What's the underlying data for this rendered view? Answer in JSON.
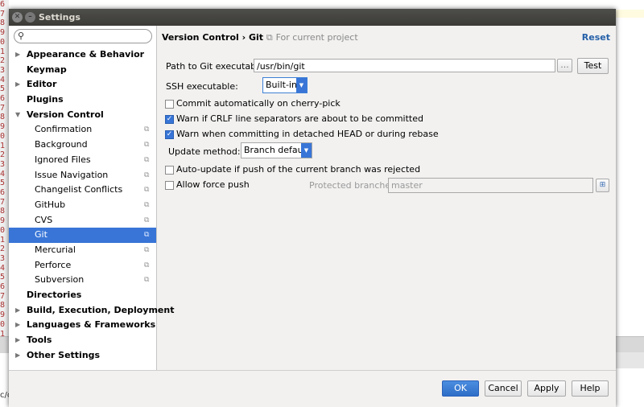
{
  "dialog": {
    "title": "Settings"
  },
  "gutter_lines": [
    "6",
    "7",
    "8",
    "9",
    "0",
    "1",
    "2",
    "3",
    "4",
    "5",
    "6",
    "7",
    "8",
    "9",
    "0",
    "1",
    "2",
    "3",
    "4",
    "5",
    "6",
    "7",
    "8",
    "9",
    "0",
    "1",
    "2",
    "3",
    "4",
    "5",
    "6",
    "7",
    "8",
    "9",
    "0",
    "1"
  ],
  "background_bottom_text": "c/c",
  "search": {
    "placeholder": ""
  },
  "tree": [
    {
      "label": "Appearance & Behavior",
      "level": 0,
      "expandable": true
    },
    {
      "label": "Keymap",
      "level": 0,
      "expandable": false
    },
    {
      "label": "Editor",
      "level": 0,
      "expandable": true
    },
    {
      "label": "Plugins",
      "level": 0,
      "expandable": false
    },
    {
      "label": "Version Control",
      "level": 0,
      "expandable": true,
      "expanded": true
    },
    {
      "label": "Confirmation",
      "level": 1
    },
    {
      "label": "Background",
      "level": 1
    },
    {
      "label": "Ignored Files",
      "level": 1
    },
    {
      "label": "Issue Navigation",
      "level": 1
    },
    {
      "label": "Changelist Conflicts",
      "level": 1
    },
    {
      "label": "GitHub",
      "level": 1
    },
    {
      "label": "CVS",
      "level": 1
    },
    {
      "label": "Git",
      "level": 1,
      "selected": true
    },
    {
      "label": "Mercurial",
      "level": 1
    },
    {
      "label": "Perforce",
      "level": 1
    },
    {
      "label": "Subversion",
      "level": 1
    },
    {
      "label": "Directories",
      "level": 0,
      "expandable": false
    },
    {
      "label": "Build, Execution, Deployment",
      "level": 0,
      "expandable": true
    },
    {
      "label": "Languages & Frameworks",
      "level": 0,
      "expandable": true
    },
    {
      "label": "Tools",
      "level": 0,
      "expandable": true
    },
    {
      "label": "Other Settings",
      "level": 0,
      "expandable": true
    }
  ],
  "header": {
    "path": "Version Control › Git",
    "project_icon": "⧉",
    "scope": "For current project",
    "reset": "Reset"
  },
  "git": {
    "path_label": "Path to Git executable:",
    "path_value": "/usr/bin/git",
    "browse_label": "...",
    "test_label": "Test",
    "ssh_label": "SSH executable:",
    "ssh_value": "Built-in",
    "cherry_pick_label": "Commit automatically on cherry-pick",
    "crlf_label": "Warn if CRLF line separators are about to be committed",
    "detached_label": "Warn when committing in detached HEAD or during rebase",
    "update_method_label": "Update method:",
    "update_method_value": "Branch default",
    "auto_update_label": "Auto-update if push of the current branch was rejected",
    "force_push_label": "Allow force push",
    "protected_label": "Protected branches:",
    "protected_value": "master"
  },
  "buttons": {
    "ok": "OK",
    "cancel": "Cancel",
    "apply": "Apply",
    "help": "Help"
  },
  "checkboxes": {
    "cherry_pick": false,
    "crlf": true,
    "detached": true,
    "auto_update": false,
    "force_push": false
  },
  "colors": {
    "selection": "#3875d7",
    "link": "#2560a8",
    "titlebar": "#3c3b37"
  }
}
